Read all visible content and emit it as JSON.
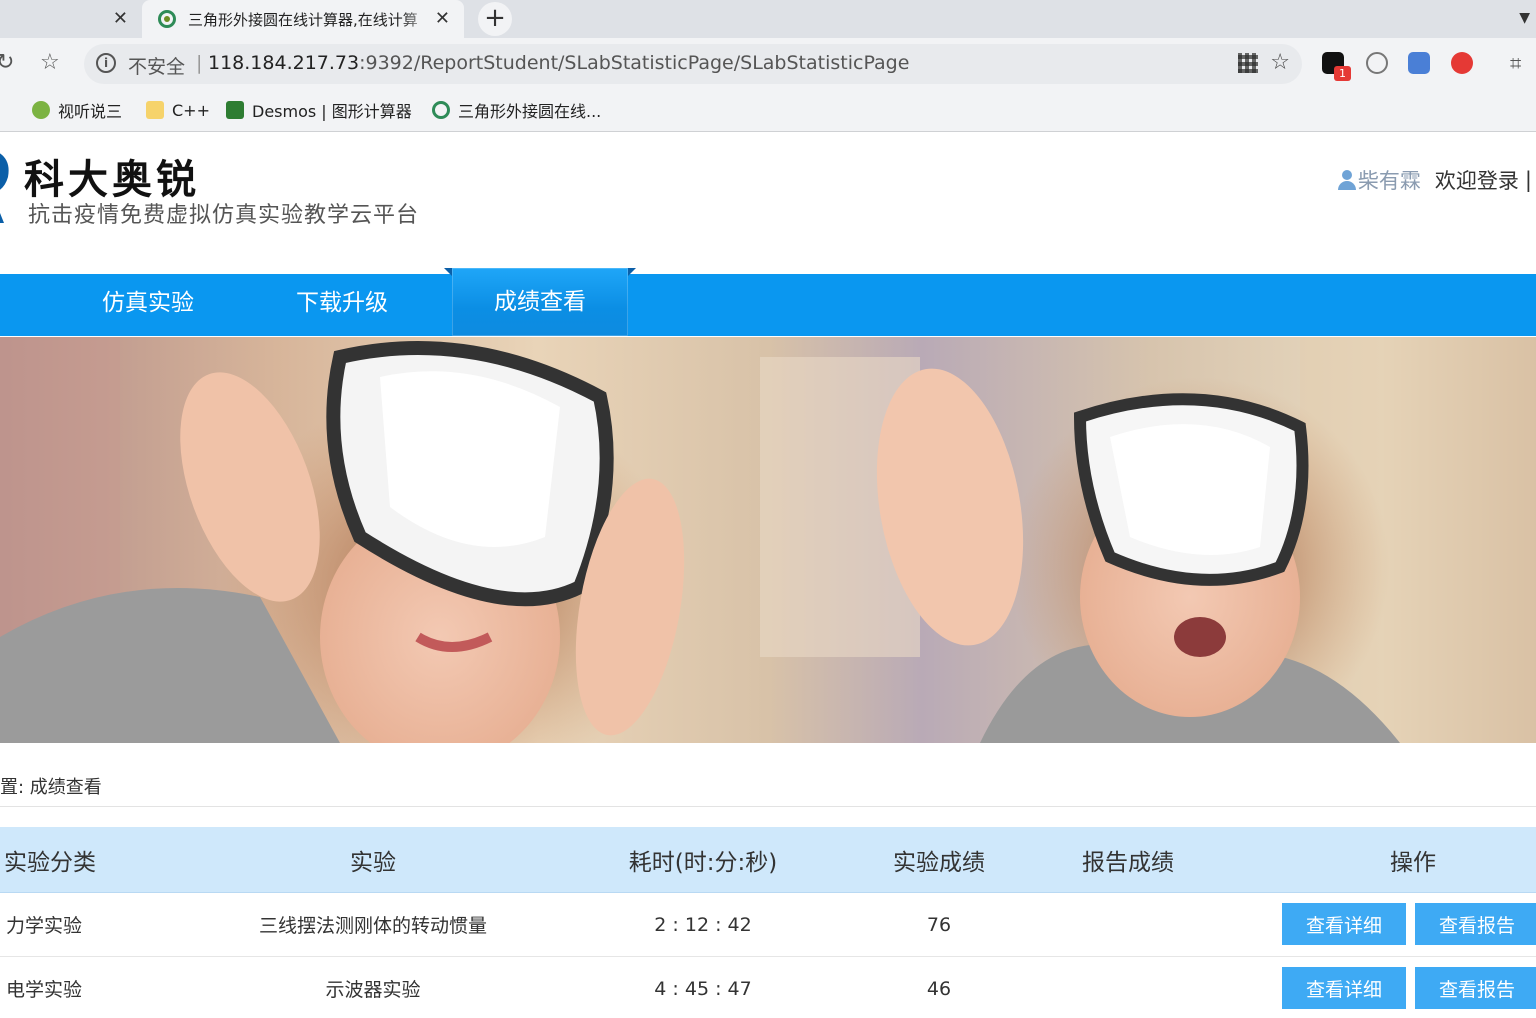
{
  "browser": {
    "tabs": [
      {
        "title": ""
      },
      {
        "title": "三角形外接圆在线计算器,在线计算"
      }
    ],
    "omnibox": {
      "security_label": "不安全",
      "separator": "|",
      "url_host": "118.184.217.73",
      "url_rest": ":9392/ReportStudent/SLabStatisticPage/SLabStatisticPage"
    },
    "extension_badge": "1",
    "bookmarks": [
      {
        "label": "视听说三",
        "icon_color": "#7cb342"
      },
      {
        "label": "C++",
        "icon_color": "#f6d36b"
      },
      {
        "label": "Desmos | 图形计算器",
        "icon_color": "#2e7d32"
      },
      {
        "label": "三角形外接圆在线...",
        "icon_color": "#2e8b57"
      }
    ]
  },
  "site": {
    "logo_title": "科大奥锐",
    "logo_subtitle": "抗击疫情免费虚拟仿真实验教学云平台",
    "user_name": "柴有霖",
    "login_label": "欢迎登录",
    "login_divider": "|",
    "nav": [
      {
        "label": "仿真实验",
        "active": false
      },
      {
        "label": "下载升级",
        "active": false
      },
      {
        "label": "成绩查看",
        "active": true
      }
    ],
    "accent_color": "#0a97f0",
    "breadcrumb": "置:  成绩查看"
  },
  "grades": {
    "columns": [
      "实验分类",
      "实验",
      "耗时(时:分:秒)",
      "实验成绩",
      "报告成绩",
      "操作"
    ],
    "rows": [
      {
        "category": "力学实验",
        "experiment": "三线摆法测刚体的转动惯量",
        "time": "2 : 12 : 42",
        "score": "76",
        "report_score": "",
        "detail_label": "查看详细",
        "report_label": "查看报告"
      },
      {
        "category": "电学实验",
        "experiment": "示波器实验",
        "time": "4 : 45 : 47",
        "score": "46",
        "report_score": "",
        "detail_label": "查看详细",
        "report_label": "查看报告"
      }
    ]
  }
}
